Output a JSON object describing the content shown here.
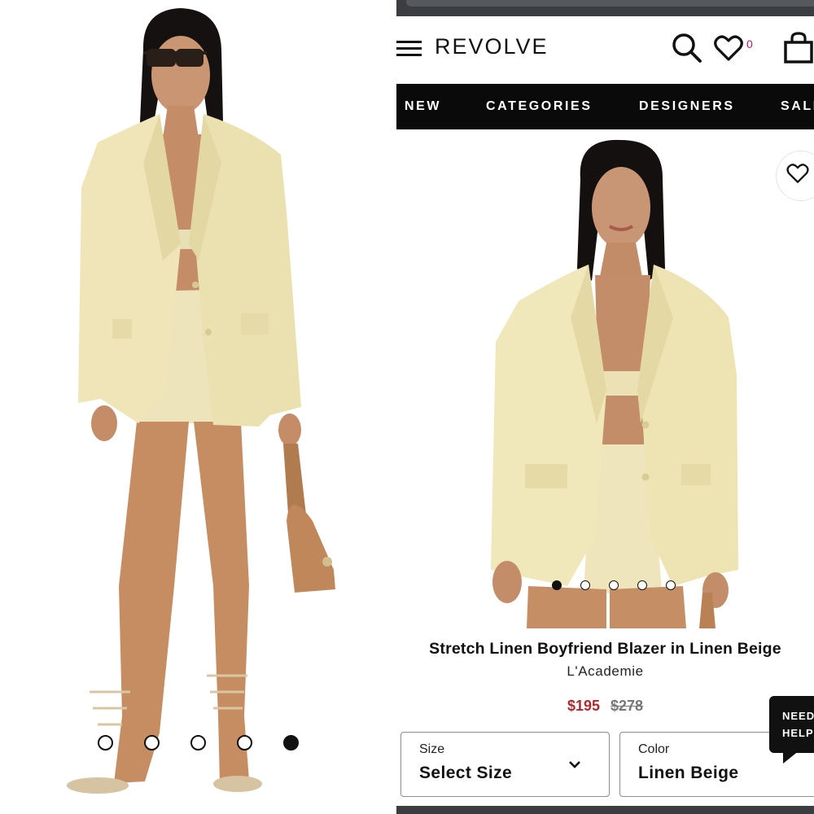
{
  "left_gallery": {
    "dot_count": 5,
    "active_dot_index": 4
  },
  "header": {
    "logo": "REVOLVE",
    "wishlist_count": "0",
    "icons": [
      "menu-icon",
      "search-icon",
      "heart-icon",
      "shopping-bag-icon"
    ]
  },
  "nav": {
    "items": [
      {
        "label": "NEW"
      },
      {
        "label": "CATEGORIES"
      },
      {
        "label": "DESIGNERS"
      },
      {
        "label": "SALE"
      }
    ]
  },
  "product": {
    "gallery_dot_count": 5,
    "active_dot_index": 0,
    "title": "Stretch Linen Boyfriend Blazer in Linen Beige",
    "brand": "L'Academie",
    "price": "$195",
    "original_price": "$278",
    "size_label": "Size",
    "size_value": "Select Size",
    "color_label": "Color",
    "color_value": "Linen Beige"
  },
  "help": {
    "line1": "NEED",
    "line2": "HELP?"
  },
  "colors": {
    "nav_bg": "#0a0a0a",
    "sale_price": "#b3282d",
    "wishlist_count": "#c2185b",
    "blazer": "#efe5b8"
  }
}
